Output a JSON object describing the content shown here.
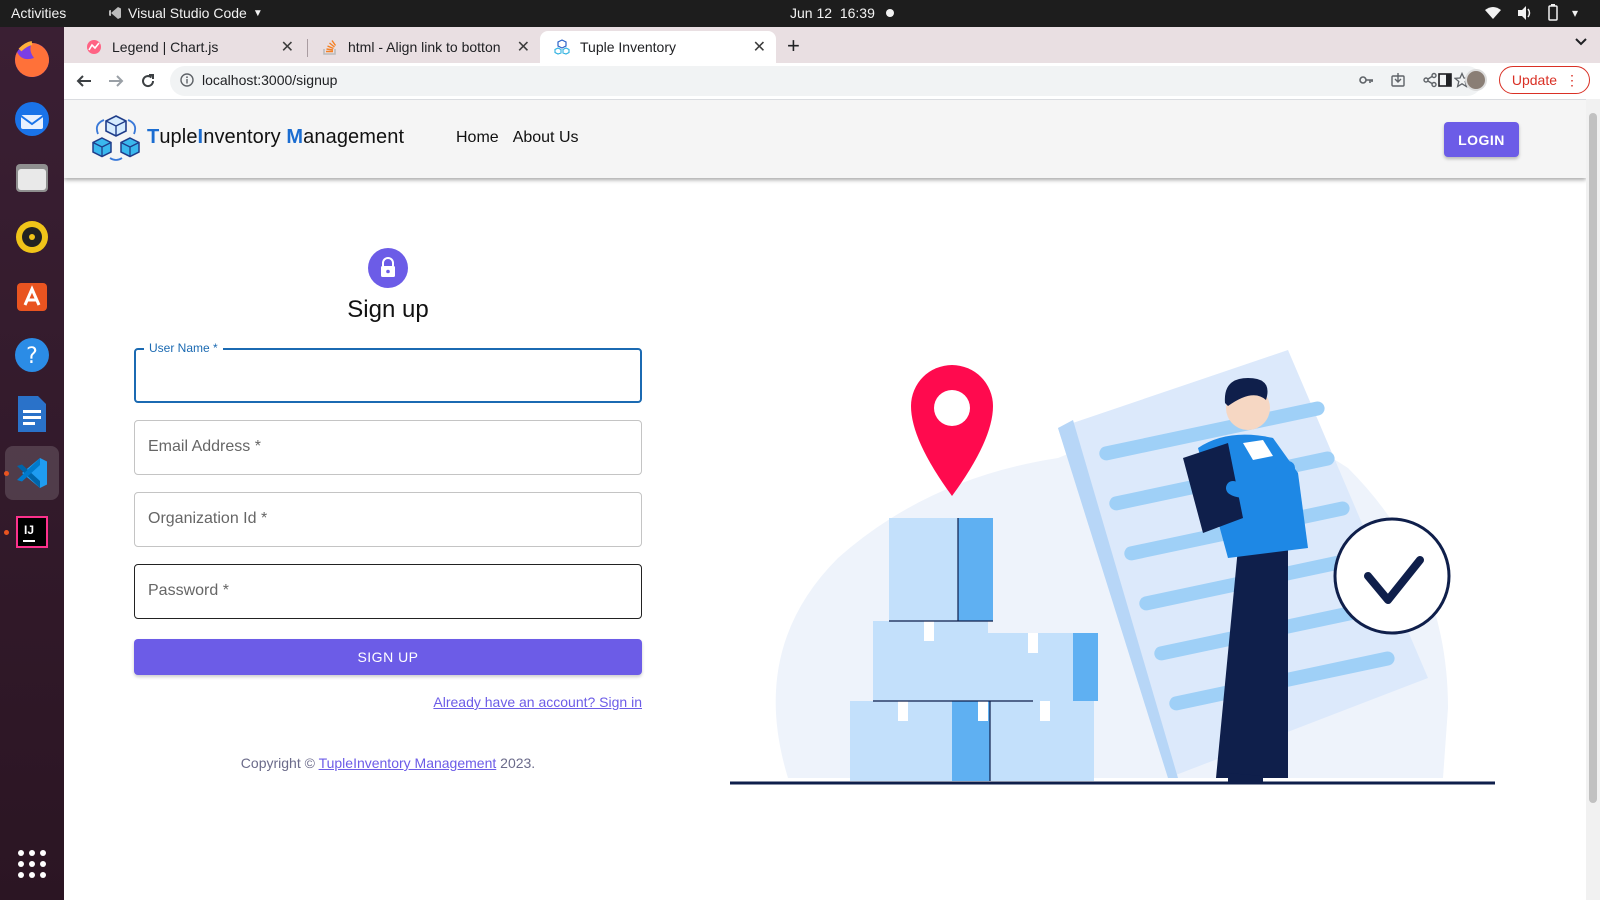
{
  "system_bar": {
    "activities": "Activities",
    "app_name": "Visual Studio Code",
    "date": "Jun 12",
    "time": "16:39"
  },
  "dock": {
    "apps": [
      "firefox-icon",
      "thunderbird-icon",
      "files-icon",
      "rhythmbox-icon",
      "app-center-icon",
      "help-icon",
      "writer-icon",
      "vscode-icon",
      "intellij-icon"
    ]
  },
  "browser": {
    "tabs": [
      {
        "title": "Legend | Chart.js"
      },
      {
        "title": "html - Align link to botton"
      },
      {
        "title": "Tuple Inventory"
      }
    ],
    "url": "localhost:3000/signup",
    "update_label": "Update"
  },
  "app": {
    "brand": {
      "t1": "T",
      "t2": "uple",
      "t3": "I",
      "t4": "nventory ",
      "t5": "M",
      "t6": "anagement"
    },
    "nav": {
      "home": "Home",
      "about": "About Us"
    },
    "login_label": "LOGIN"
  },
  "form": {
    "title": "Sign up",
    "username_label": "User Name *",
    "email_placeholder": "Email Address *",
    "org_placeholder": "Organization Id *",
    "password_placeholder": "Password *",
    "submit_label": "SIGN UP",
    "signin_link": "Already have an account? Sign in"
  },
  "footer": {
    "prefix": "Copyright © ",
    "link": "TupleInventory Management",
    "suffix": " 2023."
  },
  "colors": {
    "accent": "#6c5ce7",
    "focus": "#1b6ab2",
    "pin": "#ff0a4e",
    "navy": "#0f1f4b"
  }
}
